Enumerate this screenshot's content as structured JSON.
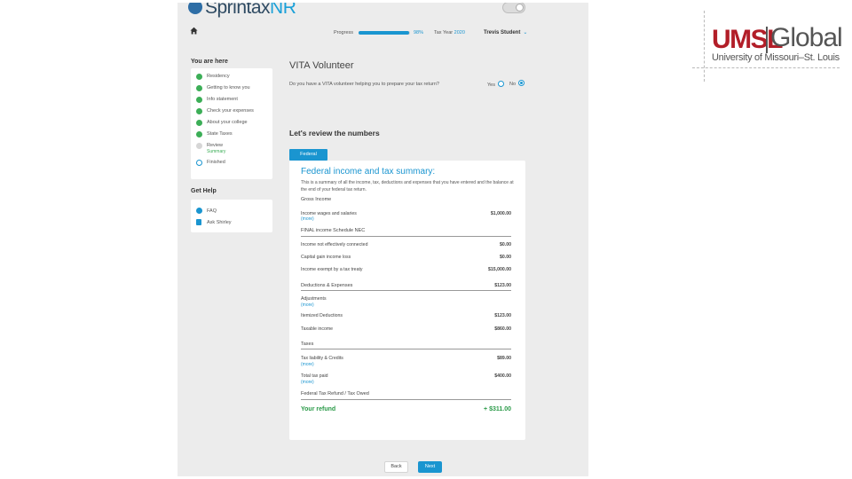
{
  "header": {
    "logo_main": "Sprintax",
    "logo_suffix": "NR",
    "progress_label": "Progress",
    "progress_value": 0.98,
    "progress_pct_label": "98%",
    "tax_year_label": "Tax Year",
    "tax_year": "2020",
    "user_name": "Trevis Student",
    "user_chevron": "⌄"
  },
  "sidebar": {
    "heading": "You are here",
    "items": [
      {
        "label": "Residency",
        "state": "done"
      },
      {
        "label": "Getting to know you",
        "state": "done"
      },
      {
        "label": "Info statement",
        "state": "done"
      },
      {
        "label": "Check your expenses",
        "state": "done"
      },
      {
        "label": "About your college",
        "state": "done"
      },
      {
        "label": "State Taxes",
        "state": "done"
      },
      {
        "label": "Review",
        "state": "current",
        "sub": "Summary"
      },
      {
        "label": "Finished",
        "state": "pending"
      }
    ],
    "help_heading": "Get Help",
    "help_items": [
      {
        "label": "FAQ",
        "icon": "question-icon"
      },
      {
        "label": "Ask Shirley",
        "icon": "chat-icon"
      }
    ]
  },
  "main": {
    "title": "VITA Volunteer",
    "question": "Do you have a VITA volunteer helping you to prepare your tax return?",
    "yes_label": "Yes",
    "no_label": "No",
    "review_heading": "Let's review the numbers",
    "tab_label": "Federal"
  },
  "summary": {
    "title": "Federal income and tax summary:",
    "description": "This is a summary of all the income, tax, deductions and expenses that you have entered and the balance at the end of your federal tax return.",
    "sections": {
      "gross_income": "Gross Income",
      "nra_income": "FINAL income Schedule NEC",
      "deductions": "Deductions & Expenses",
      "taxes": "Taxes",
      "refund_owed": "Federal Tax Refund / Tax Owed"
    },
    "rows": {
      "income_wages": {
        "label": "Income wages and salaries",
        "value": "$1,000.00",
        "more": "(more)"
      },
      "not_connected": {
        "label": "Income not effectively connected",
        "value": "$0.00"
      },
      "capital_gains": {
        "label": "Capital gain income loss",
        "value": "$0.00"
      },
      "treaty_exempt": {
        "label": "Income exempt by a tax treaty",
        "value": "$15,000.00"
      },
      "deductions_total": {
        "value": "$123.00"
      },
      "adjustments": {
        "label": "Adjustments",
        "more": "(more)"
      },
      "itemized": {
        "label": "Itemized Deductions",
        "value": "$123.00"
      },
      "taxable_income": {
        "label": "Taxable income",
        "value": "$860.00"
      },
      "tax_liability": {
        "label": "Tax liability & Credits",
        "value": "$89.00",
        "more": "(more)"
      },
      "total_paid": {
        "label": "Total tax paid",
        "value": "$400.00",
        "more": "(more)"
      }
    },
    "refund_label": "Your refund",
    "refund_value": "+ $311.00"
  },
  "footer": {
    "back_label": "Back",
    "next_label": "Next"
  },
  "brand": {
    "umsl": "UMSL",
    "global": "Global",
    "subtitle": "University of Missouri–St. Louis",
    "umsl_color": "#b21e28"
  },
  "colors": {
    "accent": "#1a95d0",
    "success": "#2a9a48"
  }
}
